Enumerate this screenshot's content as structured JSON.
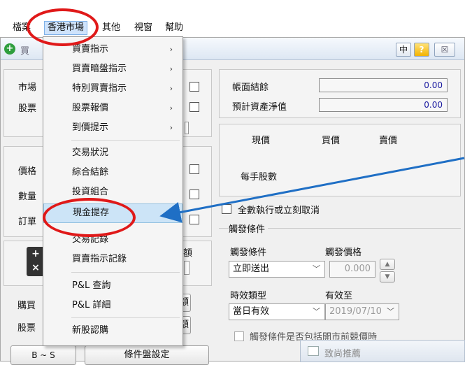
{
  "menubar": {
    "file": "檔案",
    "hk_market": "香港市場",
    "other": "其他",
    "window": "視窗",
    "help": "幫助"
  },
  "window": {
    "title_partial": "買",
    "lang_button": "中",
    "help_button": "?",
    "minimize_button": "☒"
  },
  "left_labels": {
    "market": "市場",
    "stock": "股票",
    "price": "價格",
    "quantity": "數量",
    "order": "訂單",
    "buying_power": "購買",
    "stock_lower": "股票",
    "amount1": "金額",
    "amount2": "金額",
    "col_header_end": "額"
  },
  "balance": {
    "book_balance_label": "帳面結餘",
    "book_balance_value": "0.00",
    "est_net_assets_label": "預計資產淨值",
    "est_net_assets_value": "0.00"
  },
  "quote_panel": {
    "current_price": "現價",
    "bid": "買價",
    "ask": "賣價",
    "lot_size": "每手股數"
  },
  "options": {
    "fill_or_kill": "全數執行或立刻取消",
    "trigger_group_title": "觸發條件",
    "trigger_condition_label": "觸發條件",
    "trigger_price_label": "觸發價格",
    "trigger_condition_value": "立即送出",
    "trigger_price_value": "0.000",
    "validity_label": "時效類型",
    "valid_until_label": "有效至",
    "validity_value": "當日有效",
    "valid_until_value": "2019/07/10",
    "trigger_partial_text": "觸發條件是否包括開市前競價時"
  },
  "bottom": {
    "bs_button": "B ~ S",
    "conditional_settings": "條件盤設定",
    "notice_title": "致尚推薦"
  },
  "dropdown": {
    "items": [
      {
        "label": "買賣指示",
        "arrow": "›"
      },
      {
        "label": "買賣暗盤指示",
        "arrow": "›"
      },
      {
        "label": "特別買賣指示",
        "arrow": "›"
      },
      {
        "label": "股票報價",
        "arrow": "›"
      },
      {
        "label": "到價提示",
        "arrow": "›"
      },
      {
        "label": "交易狀況",
        "arrow": ""
      },
      {
        "label": "綜合結餘",
        "arrow": ""
      },
      {
        "label": "投資組合",
        "arrow": ""
      },
      {
        "label": "現金提存",
        "arrow": ""
      },
      {
        "label": "交易記錄",
        "arrow": ""
      },
      {
        "label": "買賣指示記錄",
        "arrow": ""
      },
      {
        "label": "P&L 查詢",
        "arrow": ""
      },
      {
        "label": "P&L 詳細",
        "arrow": ""
      },
      {
        "label": "新股認購",
        "arrow": ""
      }
    ]
  },
  "colors": {
    "highlight_circle": "#e01919",
    "arrow": "#1f6fc5",
    "menu_highlight": "#cce4f7"
  }
}
